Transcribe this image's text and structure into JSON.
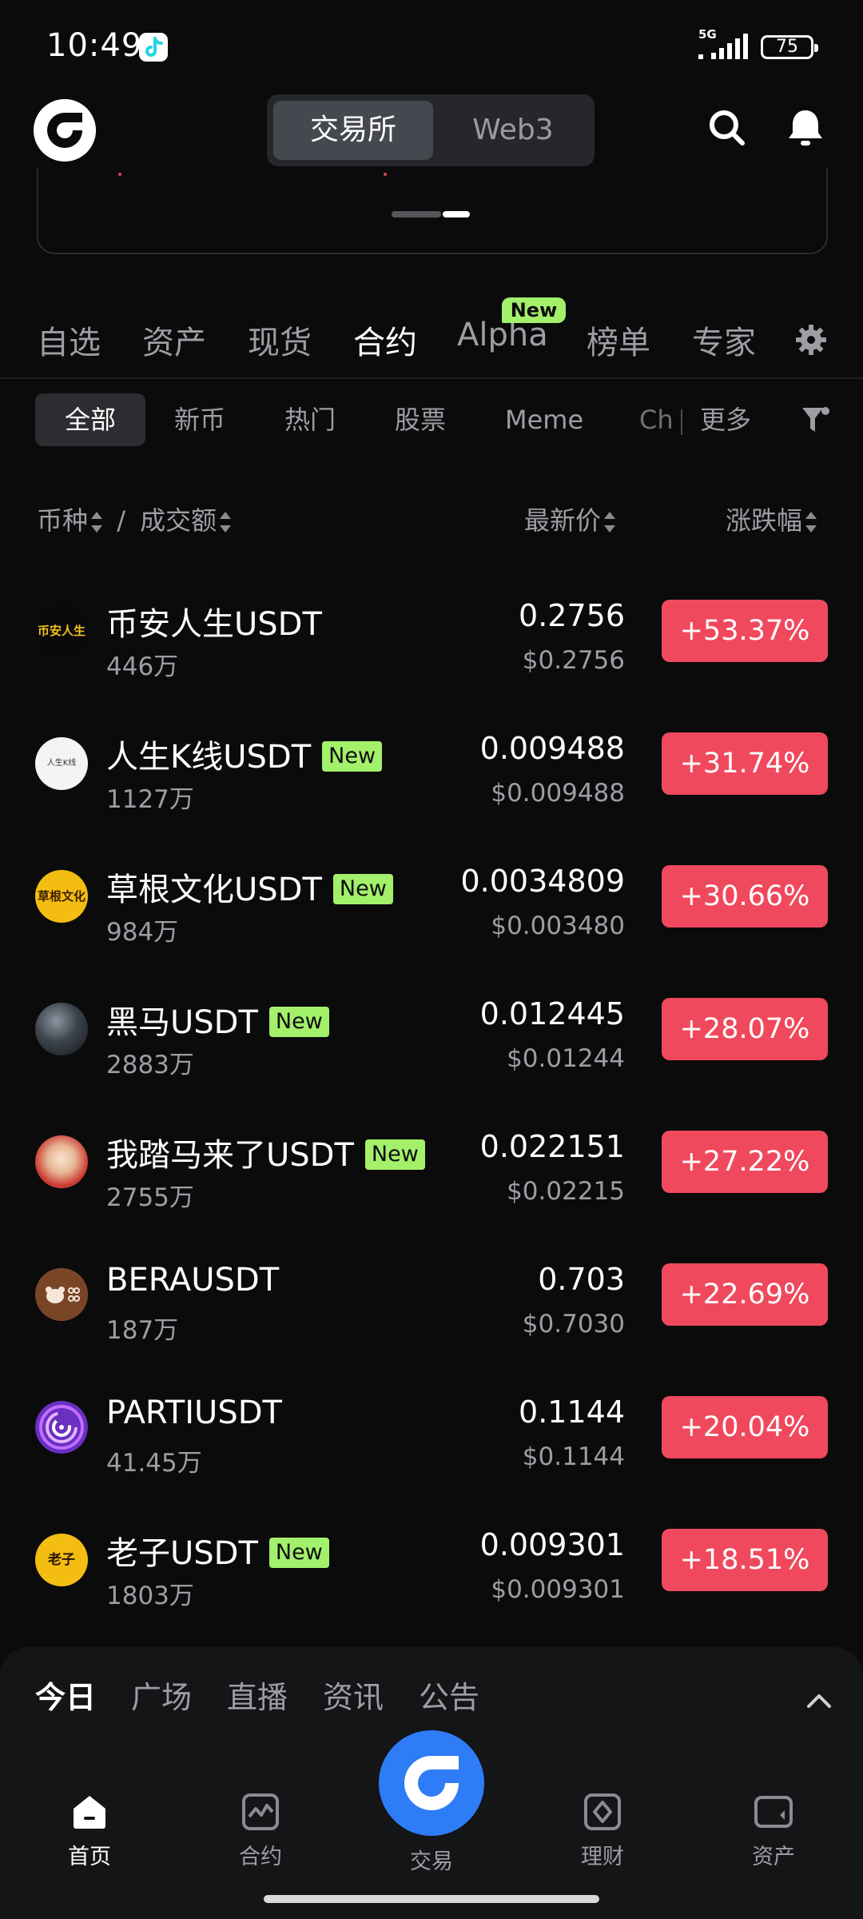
{
  "status_bar": {
    "time": "10:49",
    "network": "5G",
    "battery": "75"
  },
  "header": {
    "exchange_tab": "交易所",
    "web3_tab": "Web3"
  },
  "category_tabs": {
    "items": [
      "自选",
      "资产",
      "现货",
      "合约",
      "Alpha",
      "榜单",
      "专家"
    ],
    "active": "合约",
    "alpha_badge": "New"
  },
  "sub_filters": {
    "items": [
      "全部",
      "新币",
      "热门",
      "股票",
      "Meme",
      "Ch",
      "更多"
    ],
    "active": "全部"
  },
  "columns": {
    "coin": "币种",
    "separator": "/",
    "volume": "成交额",
    "last_price": "最新价",
    "change": "涨跌幅"
  },
  "rows": [
    {
      "name": "币安人生USDT",
      "tag": "",
      "volume": "446万",
      "price": "0.2756",
      "usd": "$0.2756",
      "change": "+53.37%",
      "avatar_text": "币安人生"
    },
    {
      "name": "人生K线USDT",
      "tag": "New",
      "volume": "1127万",
      "price": "0.009488",
      "usd": "$0.009488",
      "change": "+31.74%",
      "avatar_text": "人生K线"
    },
    {
      "name": "草根文化USDT",
      "tag": "New",
      "volume": "984万",
      "price": "0.0034809",
      "usd": "$0.003480",
      "change": "+30.66%",
      "avatar_text": "草根文化"
    },
    {
      "name": "黑马USDT",
      "tag": "New",
      "volume": "2883万",
      "price": "0.012445",
      "usd": "$0.01244",
      "change": "+28.07%",
      "avatar_text": ""
    },
    {
      "name": "我踏马来了USDT",
      "tag": "New",
      "volume": "2755万",
      "price": "0.022151",
      "usd": "$0.02215",
      "change": "+27.22%",
      "avatar_text": ""
    },
    {
      "name": "BERAUSDT",
      "tag": "",
      "volume": "187万",
      "price": "0.703",
      "usd": "$0.7030",
      "change": "+22.69%",
      "avatar_text": ""
    },
    {
      "name": "PARTIUSDT",
      "tag": "",
      "volume": "41.45万",
      "price": "0.1144",
      "usd": "$0.1144",
      "change": "+20.04%",
      "avatar_text": ""
    },
    {
      "name": "老子USDT",
      "tag": "New",
      "volume": "1803万",
      "price": "0.009301",
      "usd": "$0.009301",
      "change": "+18.51%",
      "avatar_text": "老子"
    }
  ],
  "bottom_sheet": {
    "tabs": [
      "今日",
      "广场",
      "直播",
      "资讯",
      "公告"
    ],
    "active": "今日"
  },
  "bottom_nav": {
    "home": "首页",
    "futures": "合约",
    "trade": "交易",
    "earn": "理财",
    "assets": "资产"
  },
  "colors": {
    "background": "#0b0b0c",
    "gain": "#f0495d",
    "new_badge": "#a3f06b",
    "accent": "#2e7cf6"
  }
}
